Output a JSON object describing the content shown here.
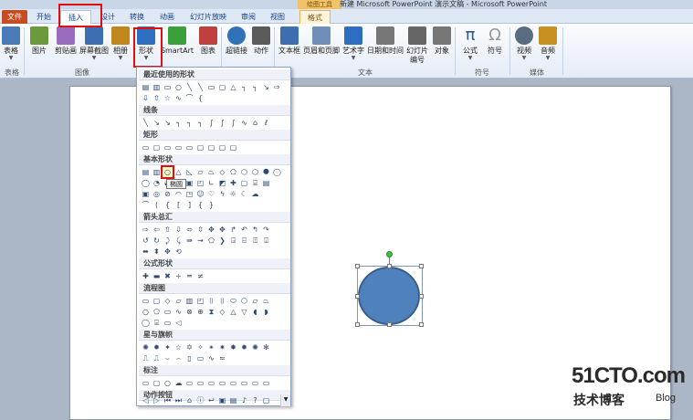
{
  "window": {
    "title": "新建 Microsoft PowerPoint 演示文稿 - Microsoft PowerPoint",
    "context_tools": "绘图工具"
  },
  "tabs": [
    "文件",
    "开始",
    "插入",
    "设计",
    "转换",
    "动画",
    "幻灯片放映",
    "审阅",
    "视图",
    "格式"
  ],
  "ribbon": {
    "buttons": [
      {
        "label": "表格",
        "icon": "table-icon",
        "color": "#4a7ab8"
      },
      {
        "label": "图片",
        "icon": "picture-icon",
        "color": "#6b9a3c"
      },
      {
        "label": "剪贴画",
        "icon": "clipart-icon",
        "color": "#9a6cc0"
      },
      {
        "label": "屏幕截图",
        "icon": "screenshot-icon",
        "color": "#3d6fb0"
      },
      {
        "label": "相册",
        "icon": "photo-album-icon",
        "color": "#c2871c"
      },
      {
        "label": "形状",
        "icon": "shapes-icon",
        "color": "#2d6ec2"
      },
      {
        "label": "SmartArt",
        "icon": "smartart-icon",
        "color": "#3aa03a"
      },
      {
        "label": "图表",
        "icon": "chart-icon",
        "color": "#c04040"
      },
      {
        "label": "超链接",
        "icon": "hyperlink-icon",
        "color": "#2f72b8"
      },
      {
        "label": "动作",
        "icon": "action-icon",
        "color": "#5a5a5a"
      },
      {
        "label": "文本框",
        "icon": "textbox-icon",
        "color": "#3d6fb0"
      },
      {
        "label": "页眉和页脚",
        "icon": "header-footer-icon",
        "color": "#6f8fb8"
      },
      {
        "label": "艺术字",
        "icon": "wordart-icon",
        "color": "#2d6ec2"
      },
      {
        "label": "日期和时间",
        "icon": "date-time-icon",
        "color": "#777777"
      },
      {
        "label": "幻灯片",
        "label2": "编号",
        "icon": "slide-number-icon",
        "color": "#666666"
      },
      {
        "label": "对象",
        "icon": "object-icon",
        "color": "#777777"
      },
      {
        "label": "公式",
        "icon": "equation-icon",
        "color": "#2d5a9a"
      },
      {
        "label": "符号",
        "icon": "symbol-icon",
        "color": "#999999"
      },
      {
        "label": "视频",
        "icon": "video-icon",
        "color": "#5a6c80"
      },
      {
        "label": "音频",
        "icon": "audio-icon",
        "color": "#c89020"
      }
    ],
    "groups": [
      "表格",
      "图像",
      "文本",
      "符号",
      "媒体"
    ]
  },
  "gallery": {
    "sections": [
      "最近使用的形状",
      "线条",
      "矩形",
      "基本形状",
      "箭头总汇",
      "公式形状",
      "流程图",
      "星与旗帜",
      "标注",
      "动作按钮"
    ],
    "tooltip": "椭圆"
  },
  "watermark": {
    "site": "51CTO.com",
    "sub": "技术博客",
    "blog": "Blog"
  }
}
